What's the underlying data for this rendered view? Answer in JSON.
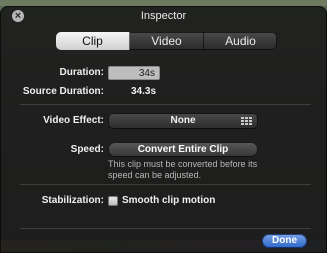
{
  "window": {
    "title": "Inspector"
  },
  "tabs": [
    {
      "label": "Clip",
      "active": true
    },
    {
      "label": "Video",
      "active": false
    },
    {
      "label": "Audio",
      "active": false
    }
  ],
  "fields": {
    "duration_label": "Duration:",
    "duration_value": "34s",
    "source_duration_label": "Source Duration:",
    "source_duration_value": "34.3s",
    "video_effect_label": "Video Effect:",
    "video_effect_value": "None",
    "speed_label": "Speed:",
    "speed_button": "Convert Entire Clip",
    "speed_note": "This clip must be converted before its speed can be adjusted.",
    "stabilization_label": "Stabilization:",
    "stabilization_option": "Smooth clip motion",
    "stabilization_checked": false
  },
  "buttons": {
    "done": "Done"
  },
  "colors": {
    "done_accent": "#2c67c9",
    "panel_bg": "#1c1c1c",
    "field_bg": "#bdbdbd"
  },
  "icons": {
    "close": "close-icon",
    "effects_browser": "grid-icon"
  }
}
